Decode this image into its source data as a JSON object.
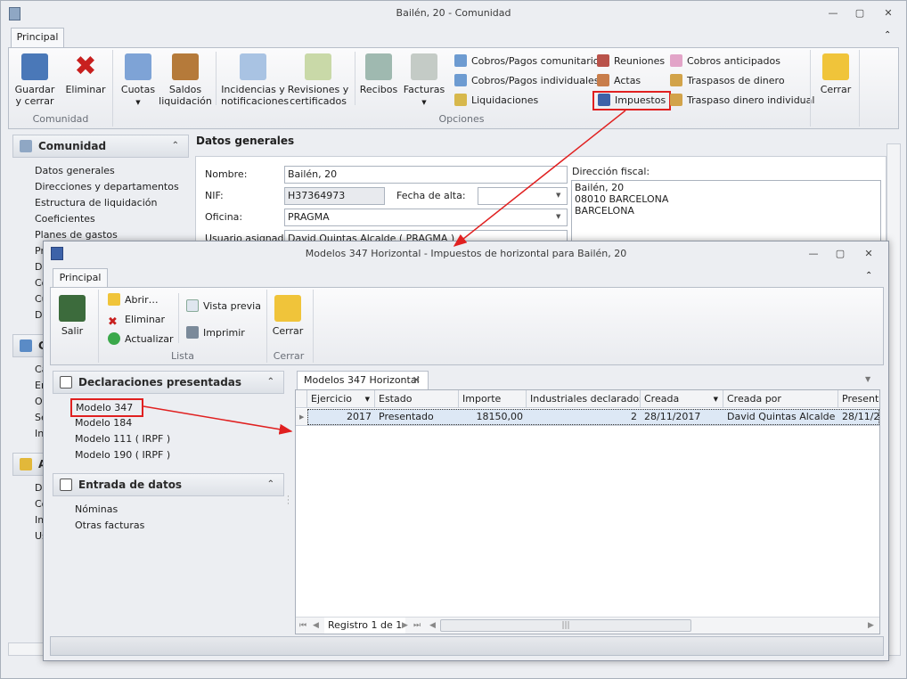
{
  "main": {
    "title": "Bailén, 20 - Comunidad",
    "tab": "Principal",
    "ribbon": {
      "guardar": "Guardar\ny cerrar",
      "eliminar": "Eliminar",
      "group_comunidad": "Comunidad",
      "cuotas": "Cuotas",
      "saldos": "Saldos\nliquidación",
      "incidencias": "Incidencias y\nnotificaciones",
      "revisiones": "Revisiones y\ncertificados",
      "recibos": "Recibos",
      "facturas": "Facturas",
      "cobros_comunitarios": "Cobros/Pagos comunitarios",
      "cobros_individuales": "Cobros/Pagos individuales",
      "liquidaciones": "Liquidaciones",
      "reuniones": "Reuniones",
      "actas": "Actas",
      "impuestos": "Impuestos",
      "cobros_anticipados": "Cobros anticipados",
      "traspasos": "Traspasos de dinero",
      "traspaso_individual": "Traspaso dinero individual",
      "group_opciones": "Opciones",
      "cerrar": "Cerrar"
    },
    "sidebar": {
      "comunidad_header": "Comunidad",
      "items": [
        "Datos generales",
        "Direcciones y departamentos",
        "Estructura de liquidación",
        "Coeficientes",
        "Planes de gastos",
        "Pr",
        "Da",
        "Co",
        "Cu",
        "De"
      ],
      "header2": "C",
      "items2": [
        "Ca",
        "En",
        "Ot",
        "Se",
        "In"
      ],
      "header3": "A",
      "items3": [
        "Do",
        "Co",
        "Im",
        "Us"
      ]
    },
    "form": {
      "section_title": "Datos generales",
      "nombre_label": "Nombre:",
      "nombre": "Bailén, 20",
      "nif_label": "NIF:",
      "nif": "H37364973",
      "fecha_label": "Fecha de alta:",
      "fecha": "",
      "oficina_label": "Oficina:",
      "oficina": "PRAGMA",
      "usuario_label": "Usuario asignado:",
      "usuario": "David Quintas Alcalde ( PRAGMA )",
      "direccion_label": "Dirección fiscal:",
      "direccion": [
        "Bailén, 20",
        "08010 BARCELONA",
        "BARCELONA"
      ]
    }
  },
  "child": {
    "title": "Modelos 347 Horizontal - Impuestos de horizontal para Bailén, 20",
    "tab": "Principal",
    "ribbon": {
      "salir": "Salir",
      "abrir": "Abrir…",
      "eliminar": "Eliminar",
      "actualizar": "Actualizar",
      "vista_previa": "Vista previa",
      "imprimir": "Imprimir",
      "group_lista": "Lista",
      "cerrar": "Cerrar",
      "group_cerrar": "Cerrar"
    },
    "panel": {
      "decl_header": "Declaraciones presentadas",
      "decl_items": [
        "Modelo 347",
        "Modelo 184",
        "Modelo 111 ( IRPF )",
        "Modelo 190 ( IRPF )"
      ],
      "entrada_header": "Entrada de datos",
      "entrada_items": [
        "Nóminas",
        "Otras facturas"
      ]
    },
    "doc_tab": "Modelos 347 Horizontal",
    "grid": {
      "columns": [
        "Ejercicio",
        "Estado",
        "Importe",
        "Industriales declarados",
        "Creada",
        "Creada por",
        "Presenta"
      ],
      "rows": [
        [
          "2017",
          "Presentado",
          "18150,00",
          "2",
          "28/11/2017",
          "David Quintas Alcalde",
          "28/11/2"
        ]
      ]
    },
    "pager": "Registro 1 de 1"
  },
  "colors": {
    "highlight": "#e02020",
    "selected_row": "#dde8f5"
  }
}
